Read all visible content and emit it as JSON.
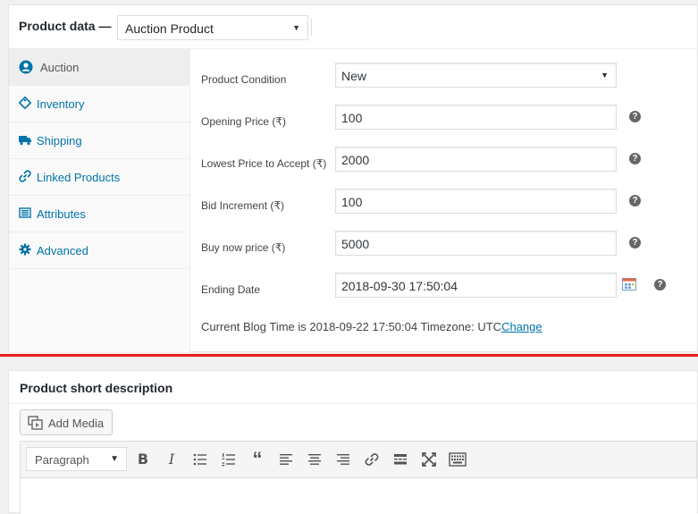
{
  "product_data": {
    "title": "Product data —",
    "type_select": {
      "value": "Auction Product"
    },
    "tabs": [
      {
        "label": "Auction",
        "icon": "auction-icon",
        "active": true
      },
      {
        "label": "Inventory",
        "icon": "inventory-tag-icon"
      },
      {
        "label": "Shipping",
        "icon": "truck-icon"
      },
      {
        "label": "Linked Products",
        "icon": "link-icon"
      },
      {
        "label": "Attributes",
        "icon": "list-icon"
      },
      {
        "label": "Advanced",
        "icon": "gear-icon"
      }
    ],
    "fields": {
      "condition": {
        "label": "Product Condition",
        "value": "New"
      },
      "opening_price": {
        "label": "Opening Price (₹)",
        "value": "100"
      },
      "lowest_price": {
        "label": "Lowest Price to Accept (₹)",
        "value": "2000"
      },
      "bid_increment": {
        "label": "Bid Increment (₹)",
        "value": "100"
      },
      "buy_now": {
        "label": "Buy now price (₹)",
        "value": "5000"
      },
      "ending_date": {
        "label": "Ending Date",
        "value": "2018-09-30 17:50:04"
      }
    },
    "blog_time": {
      "prefix": "Current Blog Time is",
      "time": "2018-09-22 17:50:04",
      "tz_label": "Timezone:",
      "tz": "UTC",
      "change_link": "Change"
    },
    "help_glyph": "?"
  },
  "short_description": {
    "title": "Product short description",
    "add_media_label": "Add Media",
    "format_select": "Paragraph",
    "toolbar_icons": [
      "bold-icon",
      "italic-icon",
      "bullet-list-icon",
      "numbered-list-icon",
      "blockquote-icon",
      "align-left-icon",
      "align-center-icon",
      "align-right-icon",
      "link-icon",
      "read-more-icon",
      "fullscreen-icon",
      "toolbar-toggle-icon"
    ]
  },
  "colors": {
    "link": "#0073aa",
    "accent_line": "#e81c1c",
    "active_tab": "#eeeeee"
  }
}
